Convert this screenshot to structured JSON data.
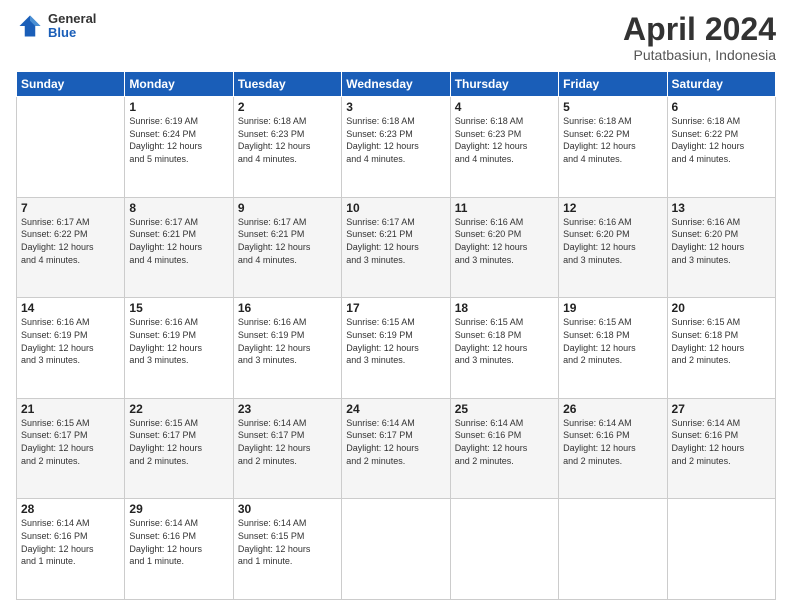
{
  "logo": {
    "general": "General",
    "blue": "Blue"
  },
  "header": {
    "title": "April 2024",
    "subtitle": "Putatbasiun, Indonesia"
  },
  "days_of_week": [
    "Sunday",
    "Monday",
    "Tuesday",
    "Wednesday",
    "Thursday",
    "Friday",
    "Saturday"
  ],
  "weeks": [
    [
      {
        "num": "",
        "info": ""
      },
      {
        "num": "1",
        "info": "Sunrise: 6:19 AM\nSunset: 6:24 PM\nDaylight: 12 hours\nand 5 minutes."
      },
      {
        "num": "2",
        "info": "Sunrise: 6:18 AM\nSunset: 6:23 PM\nDaylight: 12 hours\nand 4 minutes."
      },
      {
        "num": "3",
        "info": "Sunrise: 6:18 AM\nSunset: 6:23 PM\nDaylight: 12 hours\nand 4 minutes."
      },
      {
        "num": "4",
        "info": "Sunrise: 6:18 AM\nSunset: 6:23 PM\nDaylight: 12 hours\nand 4 minutes."
      },
      {
        "num": "5",
        "info": "Sunrise: 6:18 AM\nSunset: 6:22 PM\nDaylight: 12 hours\nand 4 minutes."
      },
      {
        "num": "6",
        "info": "Sunrise: 6:18 AM\nSunset: 6:22 PM\nDaylight: 12 hours\nand 4 minutes."
      }
    ],
    [
      {
        "num": "7",
        "info": "Sunrise: 6:17 AM\nSunset: 6:22 PM\nDaylight: 12 hours\nand 4 minutes."
      },
      {
        "num": "8",
        "info": "Sunrise: 6:17 AM\nSunset: 6:21 PM\nDaylight: 12 hours\nand 4 minutes."
      },
      {
        "num": "9",
        "info": "Sunrise: 6:17 AM\nSunset: 6:21 PM\nDaylight: 12 hours\nand 4 minutes."
      },
      {
        "num": "10",
        "info": "Sunrise: 6:17 AM\nSunset: 6:21 PM\nDaylight: 12 hours\nand 3 minutes."
      },
      {
        "num": "11",
        "info": "Sunrise: 6:16 AM\nSunset: 6:20 PM\nDaylight: 12 hours\nand 3 minutes."
      },
      {
        "num": "12",
        "info": "Sunrise: 6:16 AM\nSunset: 6:20 PM\nDaylight: 12 hours\nand 3 minutes."
      },
      {
        "num": "13",
        "info": "Sunrise: 6:16 AM\nSunset: 6:20 PM\nDaylight: 12 hours\nand 3 minutes."
      }
    ],
    [
      {
        "num": "14",
        "info": "Sunrise: 6:16 AM\nSunset: 6:19 PM\nDaylight: 12 hours\nand 3 minutes."
      },
      {
        "num": "15",
        "info": "Sunrise: 6:16 AM\nSunset: 6:19 PM\nDaylight: 12 hours\nand 3 minutes."
      },
      {
        "num": "16",
        "info": "Sunrise: 6:16 AM\nSunset: 6:19 PM\nDaylight: 12 hours\nand 3 minutes."
      },
      {
        "num": "17",
        "info": "Sunrise: 6:15 AM\nSunset: 6:19 PM\nDaylight: 12 hours\nand 3 minutes."
      },
      {
        "num": "18",
        "info": "Sunrise: 6:15 AM\nSunset: 6:18 PM\nDaylight: 12 hours\nand 3 minutes."
      },
      {
        "num": "19",
        "info": "Sunrise: 6:15 AM\nSunset: 6:18 PM\nDaylight: 12 hours\nand 2 minutes."
      },
      {
        "num": "20",
        "info": "Sunrise: 6:15 AM\nSunset: 6:18 PM\nDaylight: 12 hours\nand 2 minutes."
      }
    ],
    [
      {
        "num": "21",
        "info": "Sunrise: 6:15 AM\nSunset: 6:17 PM\nDaylight: 12 hours\nand 2 minutes."
      },
      {
        "num": "22",
        "info": "Sunrise: 6:15 AM\nSunset: 6:17 PM\nDaylight: 12 hours\nand 2 minutes."
      },
      {
        "num": "23",
        "info": "Sunrise: 6:14 AM\nSunset: 6:17 PM\nDaylight: 12 hours\nand 2 minutes."
      },
      {
        "num": "24",
        "info": "Sunrise: 6:14 AM\nSunset: 6:17 PM\nDaylight: 12 hours\nand 2 minutes."
      },
      {
        "num": "25",
        "info": "Sunrise: 6:14 AM\nSunset: 6:16 PM\nDaylight: 12 hours\nand 2 minutes."
      },
      {
        "num": "26",
        "info": "Sunrise: 6:14 AM\nSunset: 6:16 PM\nDaylight: 12 hours\nand 2 minutes."
      },
      {
        "num": "27",
        "info": "Sunrise: 6:14 AM\nSunset: 6:16 PM\nDaylight: 12 hours\nand 2 minutes."
      }
    ],
    [
      {
        "num": "28",
        "info": "Sunrise: 6:14 AM\nSunset: 6:16 PM\nDaylight: 12 hours\nand 1 minute."
      },
      {
        "num": "29",
        "info": "Sunrise: 6:14 AM\nSunset: 6:16 PM\nDaylight: 12 hours\nand 1 minute."
      },
      {
        "num": "30",
        "info": "Sunrise: 6:14 AM\nSunset: 6:15 PM\nDaylight: 12 hours\nand 1 minute."
      },
      {
        "num": "",
        "info": ""
      },
      {
        "num": "",
        "info": ""
      },
      {
        "num": "",
        "info": ""
      },
      {
        "num": "",
        "info": ""
      }
    ]
  ]
}
